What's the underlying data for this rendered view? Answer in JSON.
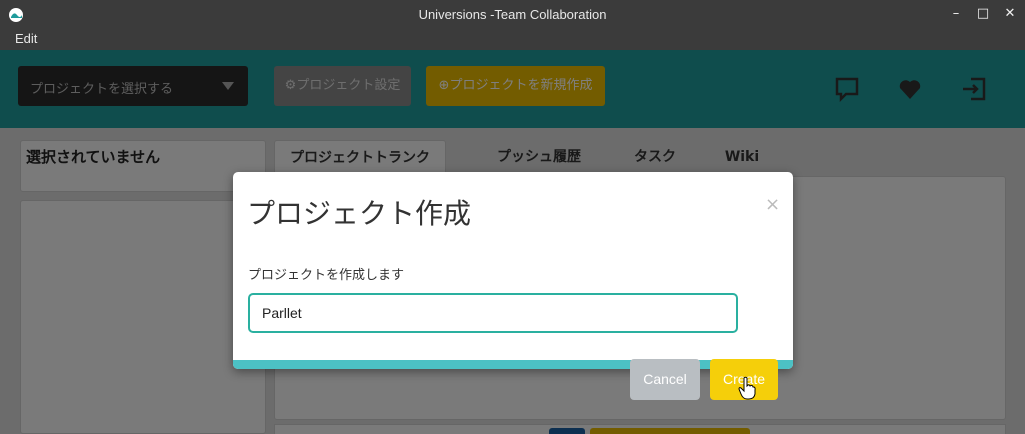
{
  "window": {
    "title": "Universions -Team Collaboration",
    "menu": [
      "Edit"
    ],
    "controls": {
      "minimize": "–",
      "maximize": "□",
      "close": "✕"
    }
  },
  "toolbar": {
    "project_select_placeholder": "プロジェクトを選択する",
    "settings_label": "プロジェクト設定",
    "new_project_label": "プロジェクトを新規作成",
    "icons": [
      "chat-icon",
      "heart-icon",
      "exit-icon"
    ],
    "accent": "#1f9b9b"
  },
  "left_panel": {
    "status": "選択されていません"
  },
  "tabs": [
    "プロジェクトトランク",
    "プッシュ履歴",
    "タスク",
    "Wiki"
  ],
  "modal": {
    "title": "プロジェクト作成",
    "close_glyph": "×",
    "description": "プロジェクトを作成します",
    "input_value": "Parllet",
    "cancel_label": "Cancel",
    "create_label": "Create",
    "colors": {
      "input_border": "#2ab0a0",
      "stripe": "#4cc1c4",
      "cancel": "#b9bec2",
      "create": "#f5cf0a"
    }
  }
}
